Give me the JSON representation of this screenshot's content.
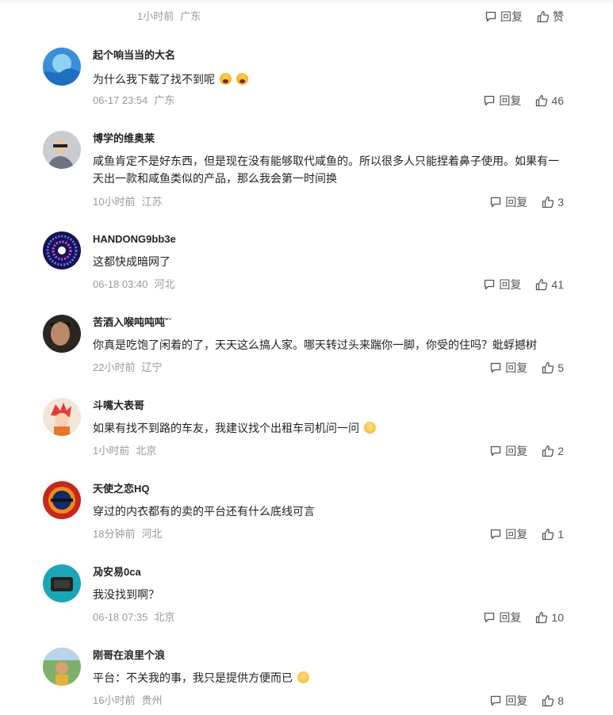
{
  "actions": {
    "reply_label": "回复",
    "like_label": "赞"
  },
  "top_partial": {
    "time": "1小时前",
    "location": "广东"
  },
  "comments": [
    {
      "username": "起个响当当的大名",
      "text": "为什么我下载了找不到呢",
      "emoji": "😱😱",
      "time": "06-17 23:54",
      "location": "广东",
      "likes": "46"
    },
    {
      "username": "博学的维奥莱",
      "text": "咸鱼肯定不是好东西，但是现在没有能够取代咸鱼的。所以很多人只能捏着鼻子使用。如果有一天出一款和咸鱼类似的产品，那么我会第一时间换",
      "time": "10小时前",
      "location": "江苏",
      "likes": "3"
    },
    {
      "username": "HANDONG9bb3e",
      "text": "这都快成暗网了",
      "time": "06-18 03:40",
      "location": "河北",
      "likes": "41"
    },
    {
      "username": "苦酒入喉吨吨吨ˇˊ",
      "text": "你真是吃饱了闲着的了，天天这么搞人家。哪天转过头来踹你一脚，你受的住吗？蚍蜉撼树",
      "time": "22小时前",
      "location": "辽宁",
      "likes": "5"
    },
    {
      "username": "斗嘴大表哥",
      "text": "如果有找不到路的车友，我建议找个出租车司机问一问",
      "emoji": "😏",
      "time": "1小时前",
      "location": "北京",
      "likes": "2"
    },
    {
      "username": "天使之恋HQ",
      "text": "穿过的内衣都有的卖的平台还有什么底线可言",
      "time": "18分钟前",
      "location": "河北",
      "likes": "1"
    },
    {
      "username": "夃安易0ca",
      "text": "我没找到啊？",
      "time": "06-18 07:35",
      "location": "北京",
      "likes": "10"
    },
    {
      "username": "刚哥在浪里个浪",
      "text": "平台：不关我的事，我只是提供方便而已",
      "emoji": "😌",
      "time": "16小时前",
      "location": "贵州",
      "likes": "8"
    }
  ]
}
